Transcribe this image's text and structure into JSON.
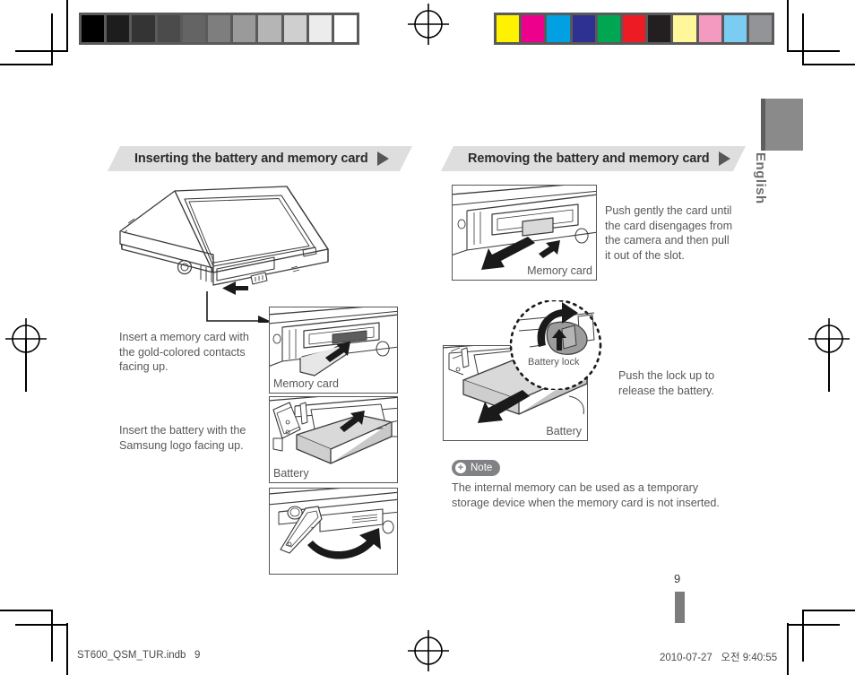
{
  "document": {
    "language_tab": "English",
    "page_number": "9"
  },
  "calibration": {
    "grayscale_label": "grayscale-step-wedge",
    "grayscale_swatches": [
      "#000000",
      "#1d1d1d",
      "#343434",
      "#4b4b4b",
      "#646464",
      "#7e7e7e",
      "#9a9a9a",
      "#b5b5b5",
      "#cfcfcf",
      "#ececec",
      "#ffffff"
    ],
    "color_label": "color-control-patches",
    "color_swatches": [
      "#fff200",
      "#ec008c",
      "#00a0e3",
      "#2e3192",
      "#00a651",
      "#ed1c24",
      "#231f20",
      "#fff79a",
      "#f49ac1",
      "#7accf2",
      "#929497"
    ]
  },
  "sections": [
    {
      "id": "inserting",
      "title": "Inserting the battery and memory card",
      "steps": [
        {
          "text": "Insert a memory card with\nthe gold-colored contacts\nfacing up.",
          "figure_caption": "Memory card"
        },
        {
          "text": "Insert the battery with the\nSamsung logo facing up.",
          "figure_caption": "Battery"
        },
        {
          "text": "",
          "figure_caption": ""
        }
      ]
    },
    {
      "id": "removing",
      "title": "Removing the battery and memory card",
      "steps": [
        {
          "text": "Push gently the card until\nthe card disengages from\nthe camera and then pull\nit out of the slot.",
          "figure_caption": "Memory card"
        },
        {
          "text": "Push the lock up to\nrelease the battery.",
          "figure_caption": "Battery",
          "callout_caption": "Battery lock"
        }
      ],
      "note": {
        "badge_icon": "plus-circle-icon",
        "badge_label": "Note",
        "text": "The internal memory can be used as a temporary\nstorage device when the memory card is not inserted."
      }
    }
  ],
  "footer": {
    "filename": "ST600_QSM_TUR.indb   9",
    "timestamp": "2010-07-27   오전 9:40:55"
  }
}
